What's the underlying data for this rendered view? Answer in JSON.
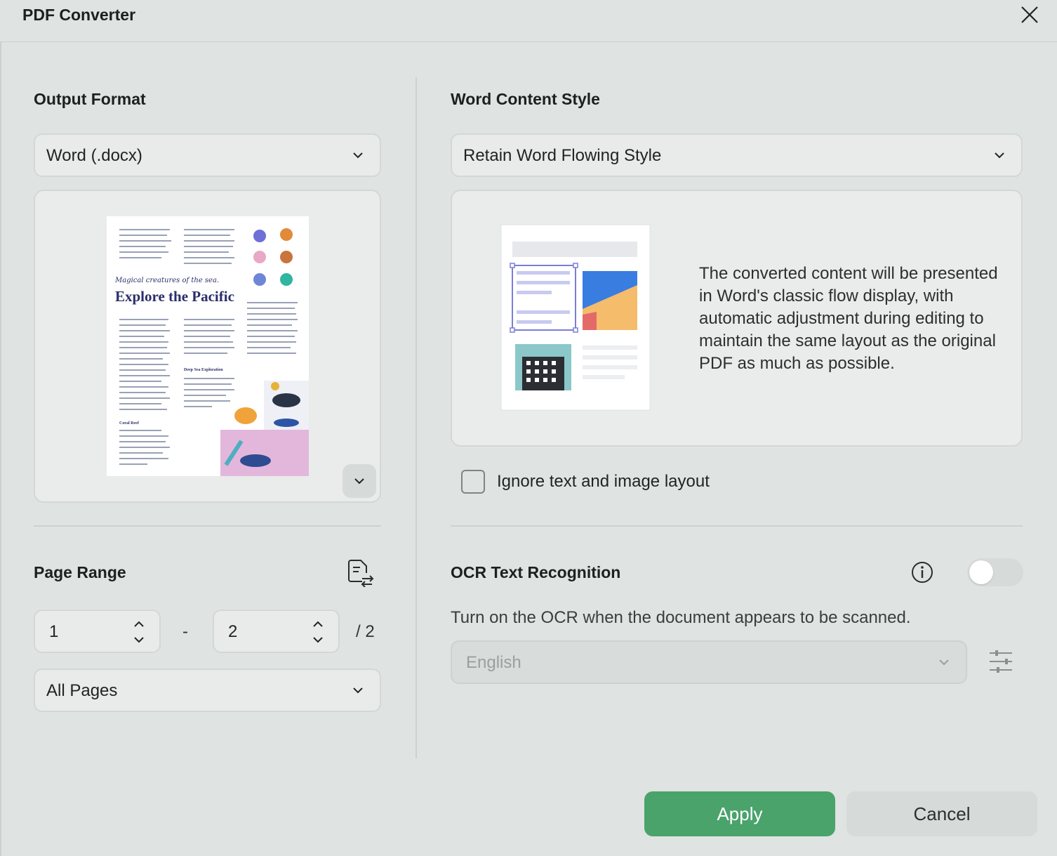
{
  "window": {
    "title": "PDF Converter"
  },
  "output_format": {
    "heading": "Output Format",
    "selected": "Word (.docx)",
    "preview": {
      "tagline": "Magical creatures of the sea.",
      "headline": "Explore the Pacific",
      "subheading_1": "Deep Sea Exploration",
      "subheading_2": "Coral Reef"
    }
  },
  "word_style": {
    "heading": "Word Content Style",
    "selected": "Retain Word Flowing Style",
    "description": "The converted content will be presented in Word's classic flow display, with automatic adjustment during editing to maintain the same layout as the original PDF as much as possible.",
    "ignore_layout_label": "Ignore text and image layout",
    "ignore_layout_checked": false
  },
  "page_range": {
    "heading": "Page Range",
    "from": "1",
    "separator": "-",
    "to": "2",
    "total": "/ 2",
    "mode": "All Pages"
  },
  "ocr": {
    "heading": "OCR Text Recognition",
    "enabled": false,
    "hint": "Turn on the OCR when the document appears to be scanned.",
    "language": "English"
  },
  "actions": {
    "apply": "Apply",
    "cancel": "Cancel"
  },
  "colors": {
    "accent": "#4aa36b",
    "background": "#dfe3e1"
  }
}
